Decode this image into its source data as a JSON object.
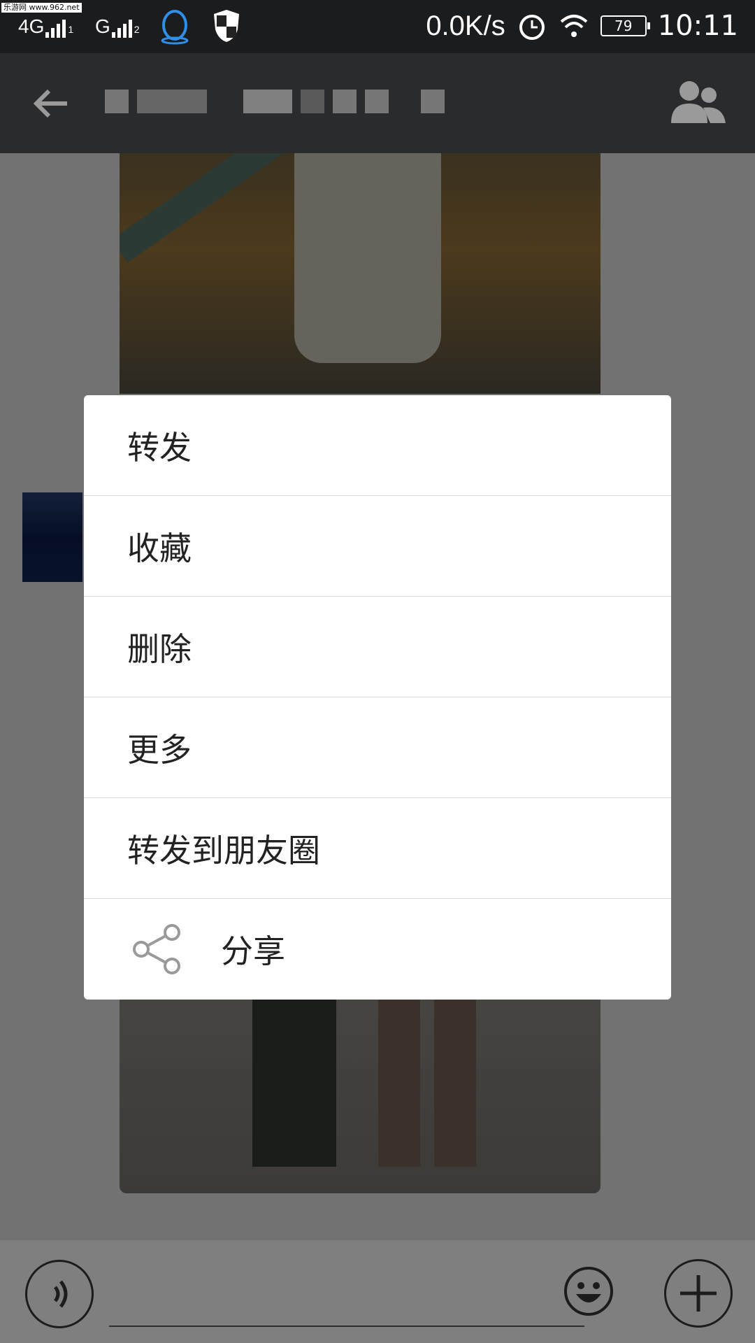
{
  "status_bar": {
    "watermark": "乐游网 www.962.net",
    "network1": "4G",
    "sim1": "1",
    "network2": "G",
    "sim2": "2",
    "speed": "0.0K/s",
    "battery": "79",
    "time": "10:11"
  },
  "title_bar": {
    "back_icon": "arrow-left-icon",
    "group_icon": "group-members-icon"
  },
  "context_menu": {
    "items": [
      {
        "label": "转发"
      },
      {
        "label": "收藏"
      },
      {
        "label": "删除"
      },
      {
        "label": "更多"
      },
      {
        "label": "转发到朋友圈"
      },
      {
        "label": "分享",
        "icon": "share-icon"
      }
    ]
  },
  "input_bar": {
    "voice_icon": "voice-icon",
    "emoji_icon": "emoji-icon",
    "plus_icon": "plus-icon"
  }
}
